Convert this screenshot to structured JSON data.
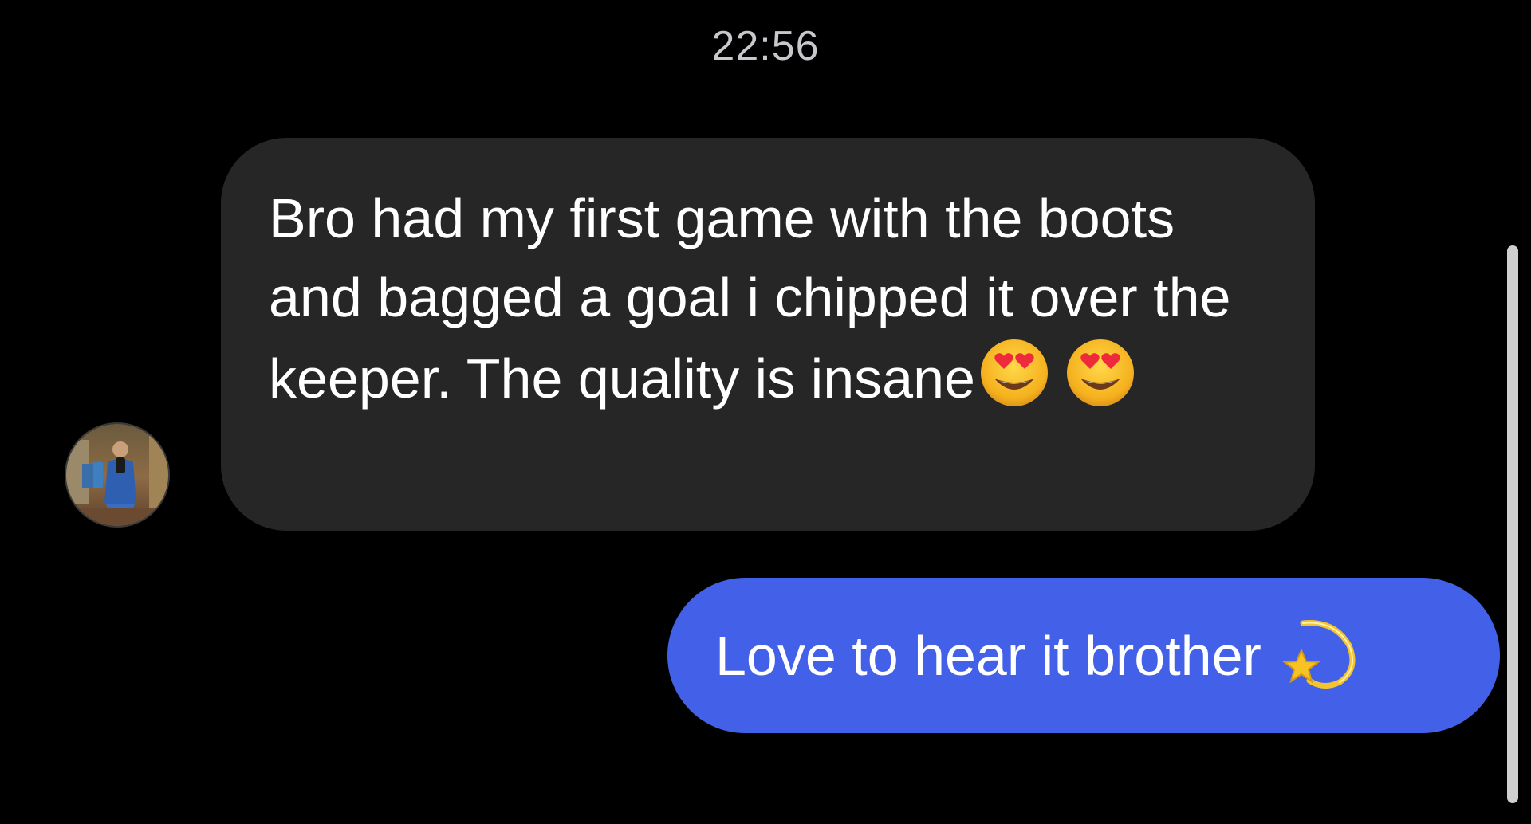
{
  "conversation": {
    "timestamp": "22:56",
    "incoming": {
      "text": "Bro had my first game with the boots and bagged a goal i chipped it over the keeper. The quality is insane",
      "emojis": [
        "heart-eyes-emoji",
        "heart-eyes-emoji"
      ],
      "avatar_icon": "user-avatar",
      "bubble_color": "#262626"
    },
    "outgoing": {
      "text": "Love to hear it brother",
      "emoji": "dizzy-star-emoji",
      "bubble_color": "#4360e8"
    }
  },
  "colors": {
    "background": "#000000",
    "timestamp_text": "#c8c8cc",
    "scrollbar": "#cfcfcf"
  }
}
